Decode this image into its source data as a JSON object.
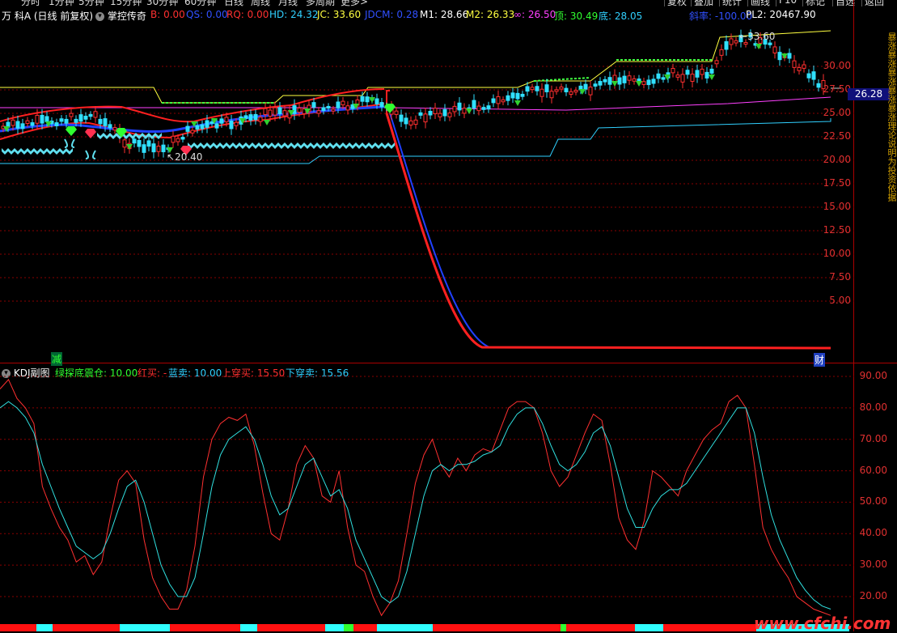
{
  "topbar": {
    "items": [
      "分时",
      "1分钟",
      "5分钟",
      "15分钟",
      "30分钟",
      "60分钟",
      "日线",
      "周线",
      "月线",
      "多周期",
      "更多>"
    ],
    "right_items": [
      "复权",
      "叠加",
      "统计",
      "画线",
      "F10",
      "标记",
      "自选",
      "返回"
    ]
  },
  "main_header": {
    "stock_name": "万 科A",
    "mode": "(日线 前复权)",
    "indicator_name": "掌控传奇",
    "values": [
      {
        "label": "B: 0.00",
        "color": "#ff3030"
      },
      {
        "label": "QS: 0.00",
        "color": "#3050ff"
      },
      {
        "label": "RQ: 0.00",
        "color": "#ff3030"
      },
      {
        "label": "HD: 24.32",
        "color": "#30d0ff"
      },
      {
        "label": "JC: 33.60",
        "color": "#ffff40"
      },
      {
        "label": "JDCM: 0.28",
        "color": "#3050ff"
      },
      {
        "label": "M1: 28.66",
        "color": "#ffffff"
      },
      {
        "label": "M2: 26.33",
        "color": "#ffff40"
      },
      {
        "label": "∞: 26.50",
        "color": "#ff40ff"
      },
      {
        "label": "顶: 30.49",
        "color": "#30ff30"
      },
      {
        "label": "底: 28.05",
        "color": "#30d0ff"
      },
      {
        "label": "斜率: -100.00",
        "color": "#3050ff"
      },
      {
        "label": "PL2: 20467.90",
        "color": "#ffffff"
      }
    ]
  },
  "main_axis": {
    "labels": [
      "30.00",
      "27.50",
      "25.00",
      "22.50",
      "20.00",
      "17.50",
      "15.00",
      "12.50",
      "10.00",
      "7.50",
      "5.00"
    ],
    "current_price": "26.28",
    "high_label": "33.60",
    "low_label": "20.40"
  },
  "markers": {
    "left_bottom": "减",
    "right_bottom": "财"
  },
  "kdj_header": {
    "name": "KDJ副图",
    "values": [
      {
        "label": "绿探底震仓: 10.00",
        "color": "#30ff30"
      },
      {
        "label": "红买: -",
        "color": "#ff3030"
      },
      {
        "label": "蓝卖: 10.00",
        "color": "#30d0ff"
      },
      {
        "label": "上穿买: 15.50",
        "color": "#ff3030"
      },
      {
        "label": "下穿卖: 15.56",
        "color": "#30d0ff"
      }
    ]
  },
  "kdj_axis": {
    "labels": [
      "90.00",
      "80.00",
      "70.00",
      "60.00",
      "50.00",
      "40.00",
      "30.00",
      "20.00"
    ]
  },
  "sidebar": {
    "text": "暴涨暴涨暴涨暴涨暴涨理论说明为投资依据"
  },
  "watermark": "www.cfchi.com",
  "chart_data": [
    {
      "type": "line",
      "title": "",
      "ylim": [
        2.5,
        33.6
      ],
      "series": [
        {
          "name": "M1",
          "color": "#ffffff"
        },
        {
          "name": "M2",
          "color": "#ffff40"
        },
        {
          "name": "∞",
          "color": "#ff40ff"
        },
        {
          "name": "底",
          "color": "#30d0ff"
        }
      ]
    },
    {
      "type": "line",
      "title": "KDJ副图",
      "ylim": [
        13,
        92
      ],
      "series": [
        {
          "name": "K",
          "color": "#ff3030",
          "values": [
            86,
            89,
            83,
            80,
            75,
            55,
            48,
            42,
            38,
            31,
            33,
            27,
            31,
            45,
            57,
            60,
            56,
            38,
            26,
            20,
            16,
            16,
            22,
            36,
            58,
            70,
            75,
            77,
            76,
            78,
            68,
            53,
            40,
            38,
            48,
            62,
            68,
            64,
            52,
            50,
            60,
            42,
            30,
            28,
            20,
            14,
            18,
            25,
            40,
            56,
            65,
            70,
            62,
            58,
            64,
            60,
            65,
            67,
            66,
            73,
            80,
            82,
            82,
            80,
            72,
            60,
            55,
            58,
            65,
            72,
            78,
            76,
            62,
            45,
            38,
            35,
            44,
            60,
            58,
            55,
            52,
            60,
            65,
            70,
            73,
            75,
            82,
            84,
            80,
            62,
            42,
            35,
            30,
            26,
            20,
            18,
            16,
            15,
            14
          ]
        },
        {
          "name": "D",
          "color": "#30e0e0",
          "values": [
            80,
            82,
            80,
            77,
            72,
            62,
            55,
            48,
            42,
            36,
            34,
            32,
            34,
            40,
            48,
            55,
            57,
            50,
            40,
            30,
            24,
            20,
            20,
            26,
            40,
            55,
            65,
            70,
            72,
            74,
            70,
            62,
            52,
            46,
            48,
            55,
            62,
            64,
            58,
            52,
            54,
            48,
            38,
            32,
            26,
            20,
            18,
            20,
            28,
            40,
            52,
            60,
            62,
            60,
            62,
            62,
            63,
            65,
            66,
            68,
            74,
            78,
            80,
            80,
            75,
            68,
            62,
            60,
            62,
            66,
            72,
            74,
            68,
            58,
            48,
            42,
            42,
            48,
            52,
            54,
            54,
            56,
            60,
            64,
            68,
            72,
            76,
            80,
            80,
            72,
            58,
            46,
            38,
            32,
            26,
            22,
            19,
            17,
            16
          ]
        }
      ]
    }
  ]
}
